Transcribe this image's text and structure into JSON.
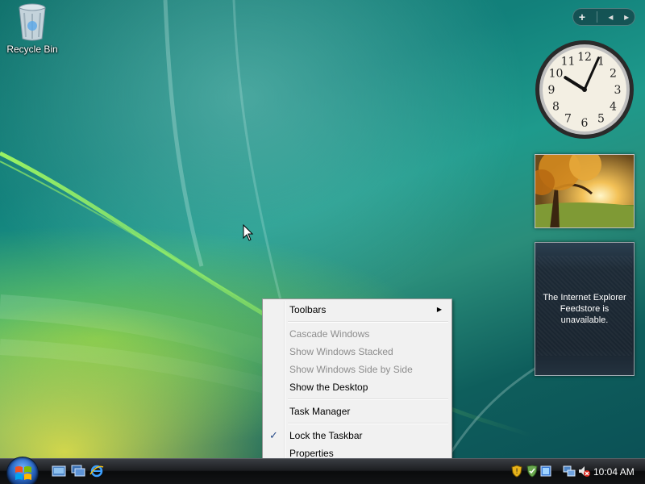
{
  "desktop": {
    "icons": [
      {
        "label": "Recycle Bin",
        "icon": "recycle-bin-icon"
      }
    ]
  },
  "sidebar": {
    "controls": {
      "add": "+",
      "prev": "◂",
      "next": "▸"
    },
    "clock": {
      "hour": 10,
      "minute": 4
    },
    "feed_gadget": {
      "message": "The Internet Explorer Feedstore is unavailable."
    }
  },
  "context_menu": {
    "items": [
      {
        "label": "Toolbars",
        "enabled": true,
        "submenu": true
      },
      {
        "label": "Cascade Windows",
        "enabled": false
      },
      {
        "label": "Show Windows Stacked",
        "enabled": false
      },
      {
        "label": "Show Windows Side by Side",
        "enabled": false
      },
      {
        "label": "Show the Desktop",
        "enabled": true
      },
      {
        "label": "Task Manager",
        "enabled": true
      },
      {
        "label": "Lock the Taskbar",
        "enabled": true,
        "checked": true
      },
      {
        "label": "Properties",
        "enabled": true
      }
    ],
    "check_glyph": "✓",
    "arrow_glyph": "▶"
  },
  "taskbar": {
    "quick_launch": [
      "show-desktop-icon",
      "switch-windows-icon",
      "internet-explorer-icon"
    ],
    "tray": {
      "icons": [
        "security-shield-icon",
        "windows-defender-icon",
        "windows-update-icon",
        "network-icon",
        "volume-muted-icon"
      ],
      "time": "10:04 AM"
    }
  }
}
